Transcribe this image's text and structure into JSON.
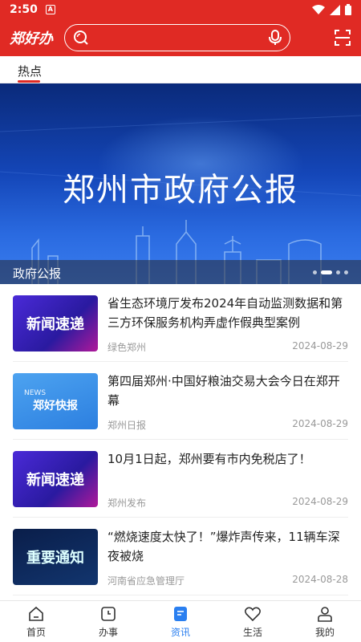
{
  "status": {
    "time": "2:50",
    "notif": "A"
  },
  "app": {
    "logo": "郑好办"
  },
  "search": {
    "placeholder": ""
  },
  "tabs": [
    {
      "label": "热点"
    }
  ],
  "banner": {
    "title": "郑州市政府公报",
    "caption": "政府公报",
    "slide_index": 2,
    "slide_count": 4
  },
  "news": [
    {
      "thumb": "新闻速递",
      "title": "省生态环境厅发布2024年自动监测数据和第三方环保服务机构弄虚作假典型案例",
      "source": "绿色郑州",
      "date": "2024-08-29"
    },
    {
      "thumb_tag": "NEWS",
      "thumb": "郑好快报",
      "title": "第四届郑州·中国好粮油交易大会今日在郑开幕",
      "source": "郑州日报",
      "date": "2024-08-29"
    },
    {
      "thumb": "新闻速递",
      "title": "10月1日起，郑州要有市内免税店了！",
      "source": "郑州发布",
      "date": "2024-08-29"
    },
    {
      "thumb": "重要通知",
      "title": "“燃烧速度太快了！”爆炸声传来，11辆车深夜被烧",
      "source": "河南省应急管理厅",
      "date": "2024-08-28"
    }
  ],
  "nav": [
    {
      "label": "首页",
      "icon": "home-icon"
    },
    {
      "label": "办事",
      "icon": "clock-icon"
    },
    {
      "label": "资讯",
      "icon": "news-icon",
      "active": true
    },
    {
      "label": "生活",
      "icon": "heart-icon"
    },
    {
      "label": "我的",
      "icon": "user-icon"
    }
  ],
  "colors": {
    "brand": "#e02a24",
    "active": "#2a7ff0"
  }
}
